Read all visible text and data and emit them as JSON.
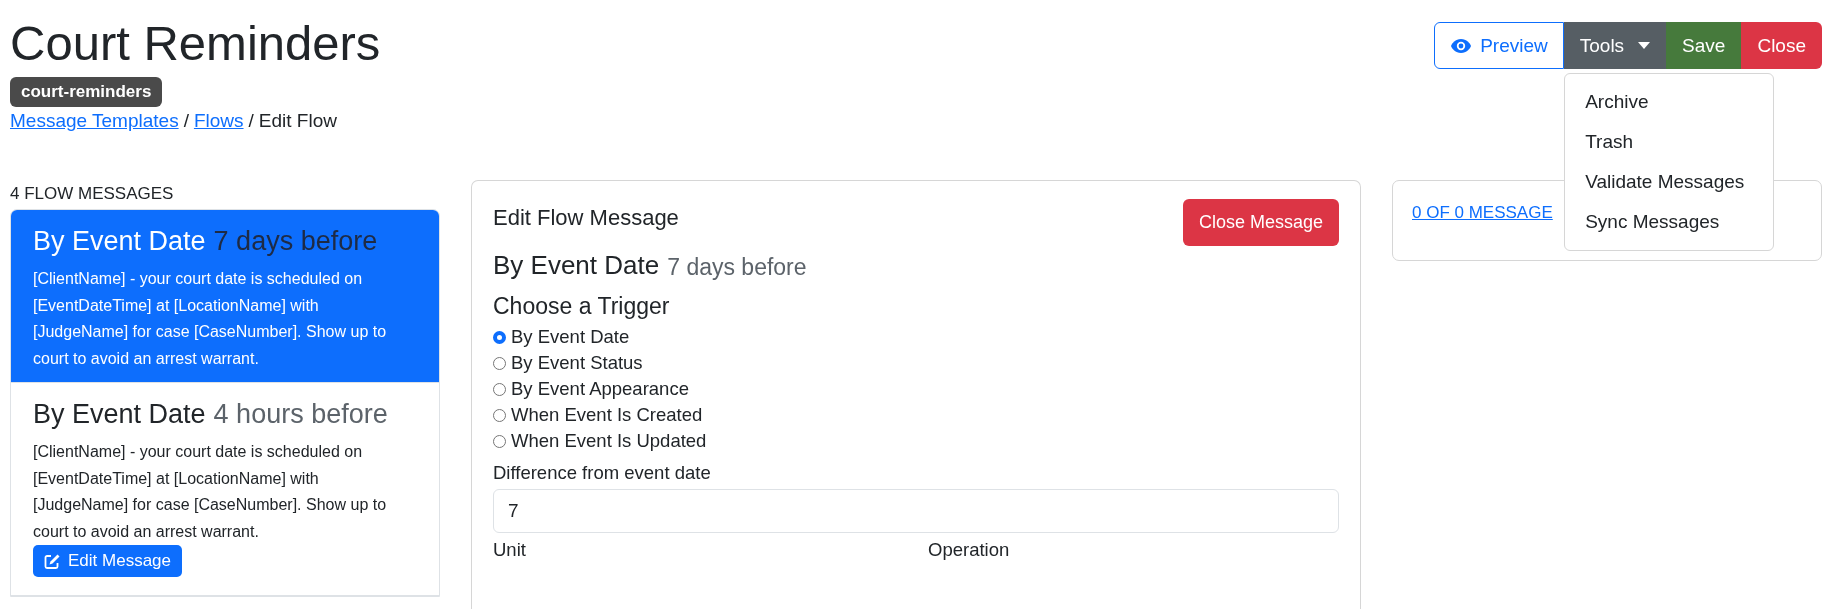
{
  "page": {
    "title": "Court Reminders",
    "badge": "court-reminders"
  },
  "breadcrumb": [
    {
      "label": "Message Templates",
      "kind": "link"
    },
    {
      "label": "/",
      "kind": "separator"
    },
    {
      "label": "Flows",
      "kind": "link"
    },
    {
      "label": "/",
      "kind": "separator"
    },
    {
      "label": "Edit Flow",
      "kind": "current"
    }
  ],
  "actions": [
    {
      "label": "Preview",
      "kind": "outline"
    },
    {
      "label": "Tools",
      "kind": "dropdown",
      "expanded": true
    },
    {
      "label": "Save",
      "kind": "success"
    },
    {
      "label": "Close",
      "kind": "danger"
    }
  ],
  "tools_menu": [
    "Archive",
    "Trash",
    "Validate Messages",
    "Sync Messages"
  ],
  "flow_messages": {
    "heading": "4 FLOW MESSAGES",
    "items": [
      {
        "trigger": "By Event Date",
        "timing": "7 days before",
        "body": "[ClientName] - your court date is scheduled on [EventDateTime] at [LocationName] with [JudgeName] for case [CaseNumber]. Show up to court to avoid an arrest warrant.",
        "selected": true
      },
      {
        "trigger": "By Event Date",
        "timing": "4 hours before",
        "body": "[ClientName] - your court date is scheduled on [EventDateTime] at [LocationName] with [JudgeName] for case [CaseNumber]. Show up to court to avoid an arrest warrant.",
        "selected": false,
        "action": "Edit Message"
      }
    ]
  },
  "editor": {
    "title": "Edit Flow Message",
    "close_button": "Close Message",
    "trigger": "By Event Date",
    "timing": "7 days before",
    "trigger_heading": "Choose a Trigger",
    "options": [
      {
        "label": "By Event Date",
        "selected": true
      },
      {
        "label": "By Event Status",
        "selected": false
      },
      {
        "label": "By Event Appearance",
        "selected": false
      },
      {
        "label": "When Event Is Created",
        "selected": false
      },
      {
        "label": "When Event Is Updated",
        "selected": false
      }
    ],
    "difference_label": "Difference from event date",
    "difference_value": "7",
    "unit_label": "Unit",
    "operation_label": "Operation"
  },
  "messages_panel": {
    "link": "0 OF 0 MESSAGE"
  }
}
